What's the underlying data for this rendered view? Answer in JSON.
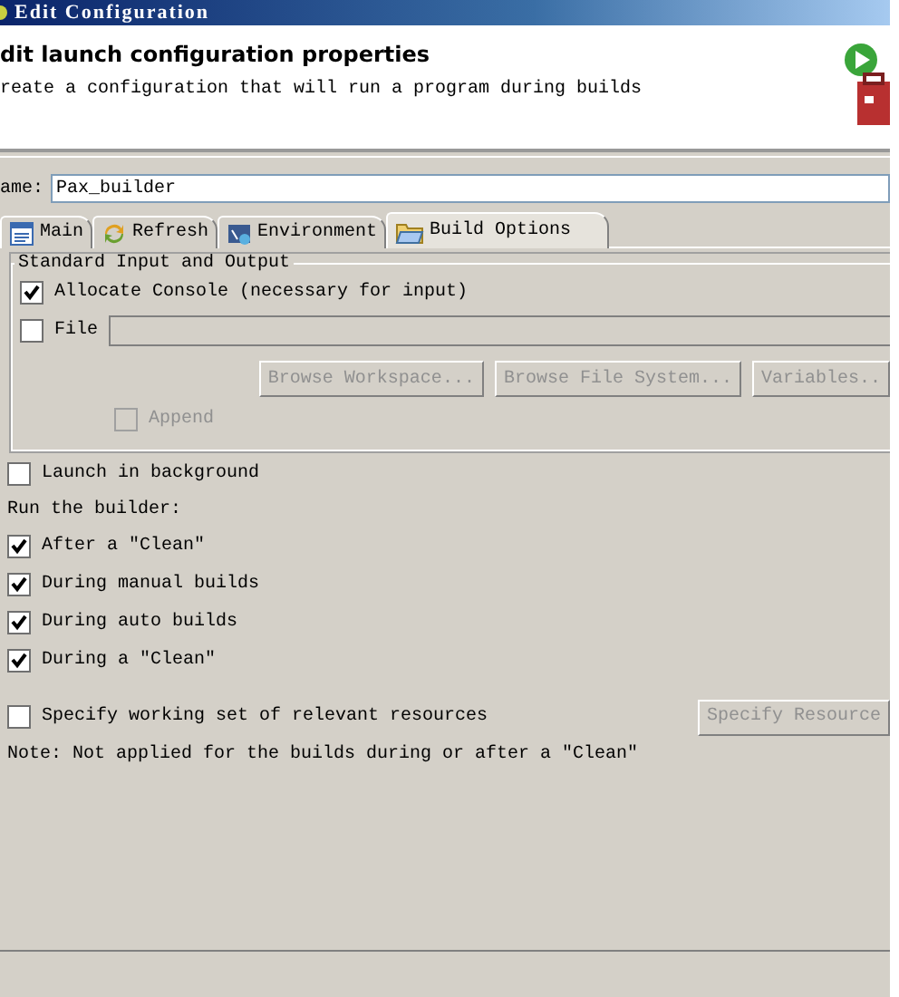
{
  "window": {
    "title": "Edit Configuration"
  },
  "header": {
    "title": "dit launch configuration properties",
    "description": "reate a configuration that will run a program during builds"
  },
  "name_field": {
    "label": "ame:",
    "value": "Pax_builder"
  },
  "tabs": [
    {
      "label": "Main",
      "selected": false
    },
    {
      "label": "Refresh",
      "selected": false
    },
    {
      "label": "Environment",
      "selected": false
    },
    {
      "label": "Build Options",
      "selected": true
    }
  ],
  "io_group": {
    "title": "Standard Input and Output",
    "allocate_console": {
      "label": "Allocate Console (necessary for input)",
      "checked": true
    },
    "file": {
      "label": "File",
      "checked": false
    },
    "buttons": [
      {
        "label": "Browse Workspace...",
        "disabled": true
      },
      {
        "label": "Browse File System...",
        "disabled": true
      },
      {
        "label": "Variables..",
        "disabled": true
      }
    ],
    "append": {
      "label": "Append",
      "checked": false,
      "disabled": true
    }
  },
  "launch_in_background": {
    "label": "Launch in background",
    "checked": false
  },
  "run_builder": {
    "label": "Run the builder:",
    "options": [
      {
        "label": "After a \"Clean\"",
        "checked": true
      },
      {
        "label": "During manual builds",
        "checked": true
      },
      {
        "label": "During auto builds",
        "checked": true
      },
      {
        "label": "During a \"Clean\"",
        "checked": true
      }
    ]
  },
  "working_set": {
    "label": "Specify working set of relevant resources",
    "checked": false,
    "button": {
      "label": "Specify Resource",
      "disabled": true
    }
  },
  "note": "Note: Not applied for the builds during or after a \"Clean\""
}
